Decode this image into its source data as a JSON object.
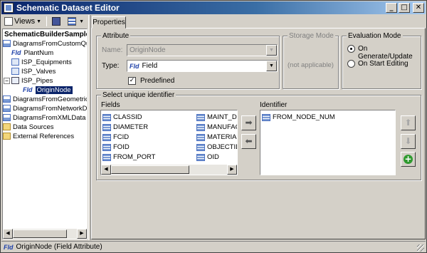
{
  "window": {
    "title": "Schematic Dataset Editor",
    "minimize": "_",
    "maximize": "□",
    "close": "✕"
  },
  "toolbar": {
    "views_label": "Views"
  },
  "tree": {
    "root": "SchematicBuilderSamples",
    "nodes": [
      "DiagramsFromCustomQueries",
      "PlantNum",
      "ISP_Equipments",
      "ISP_Valves",
      "ISP_Pipes",
      "OriginNode",
      "DiagramsFromGeometricNetwork",
      "DiagramsFromNetworkDataset",
      "DiagramsFromXMLData",
      "Data Sources",
      "External References"
    ],
    "fld_glyph": "Fld",
    "expander_minus": "−",
    "expander_plus": "+"
  },
  "tabs": {
    "properties": "Properties"
  },
  "attribute": {
    "group_label": "Attribute",
    "name_label": "Name:",
    "name_value": "OriginNode",
    "type_label": "Type:",
    "type_glyph": "Fld",
    "type_value": "Field",
    "predefined_label": "Predefined",
    "predefined_checked": "✓"
  },
  "storage": {
    "group_label": "Storage Mode",
    "value": "(not applicable)"
  },
  "evaluation": {
    "group_label": "Evaluation Mode",
    "option1": "On Generate/Update",
    "option2": "On Start Editing"
  },
  "identifier": {
    "group_label": "Select unique identifier",
    "fields_label": "Fields",
    "identifier_label": "Identifier",
    "fields_col1": [
      "CLASSID",
      "DIAMETER",
      "FCID",
      "FOID",
      "FROM_PORT"
    ],
    "fields_col2": [
      "MAINT_DA",
      "MANUFAC",
      "MATERIAL",
      "OBJECTID",
      "OID"
    ],
    "identifier_items": [
      "FROM_NODE_NUM"
    ],
    "add_arrow": "➡",
    "remove_arrow": "⬅",
    "up_arrow": "⬆",
    "down_arrow": "⬇",
    "plus": "+"
  },
  "statusbar": {
    "glyph": "Fld",
    "text": "OriginNode (Field Attribute)"
  }
}
